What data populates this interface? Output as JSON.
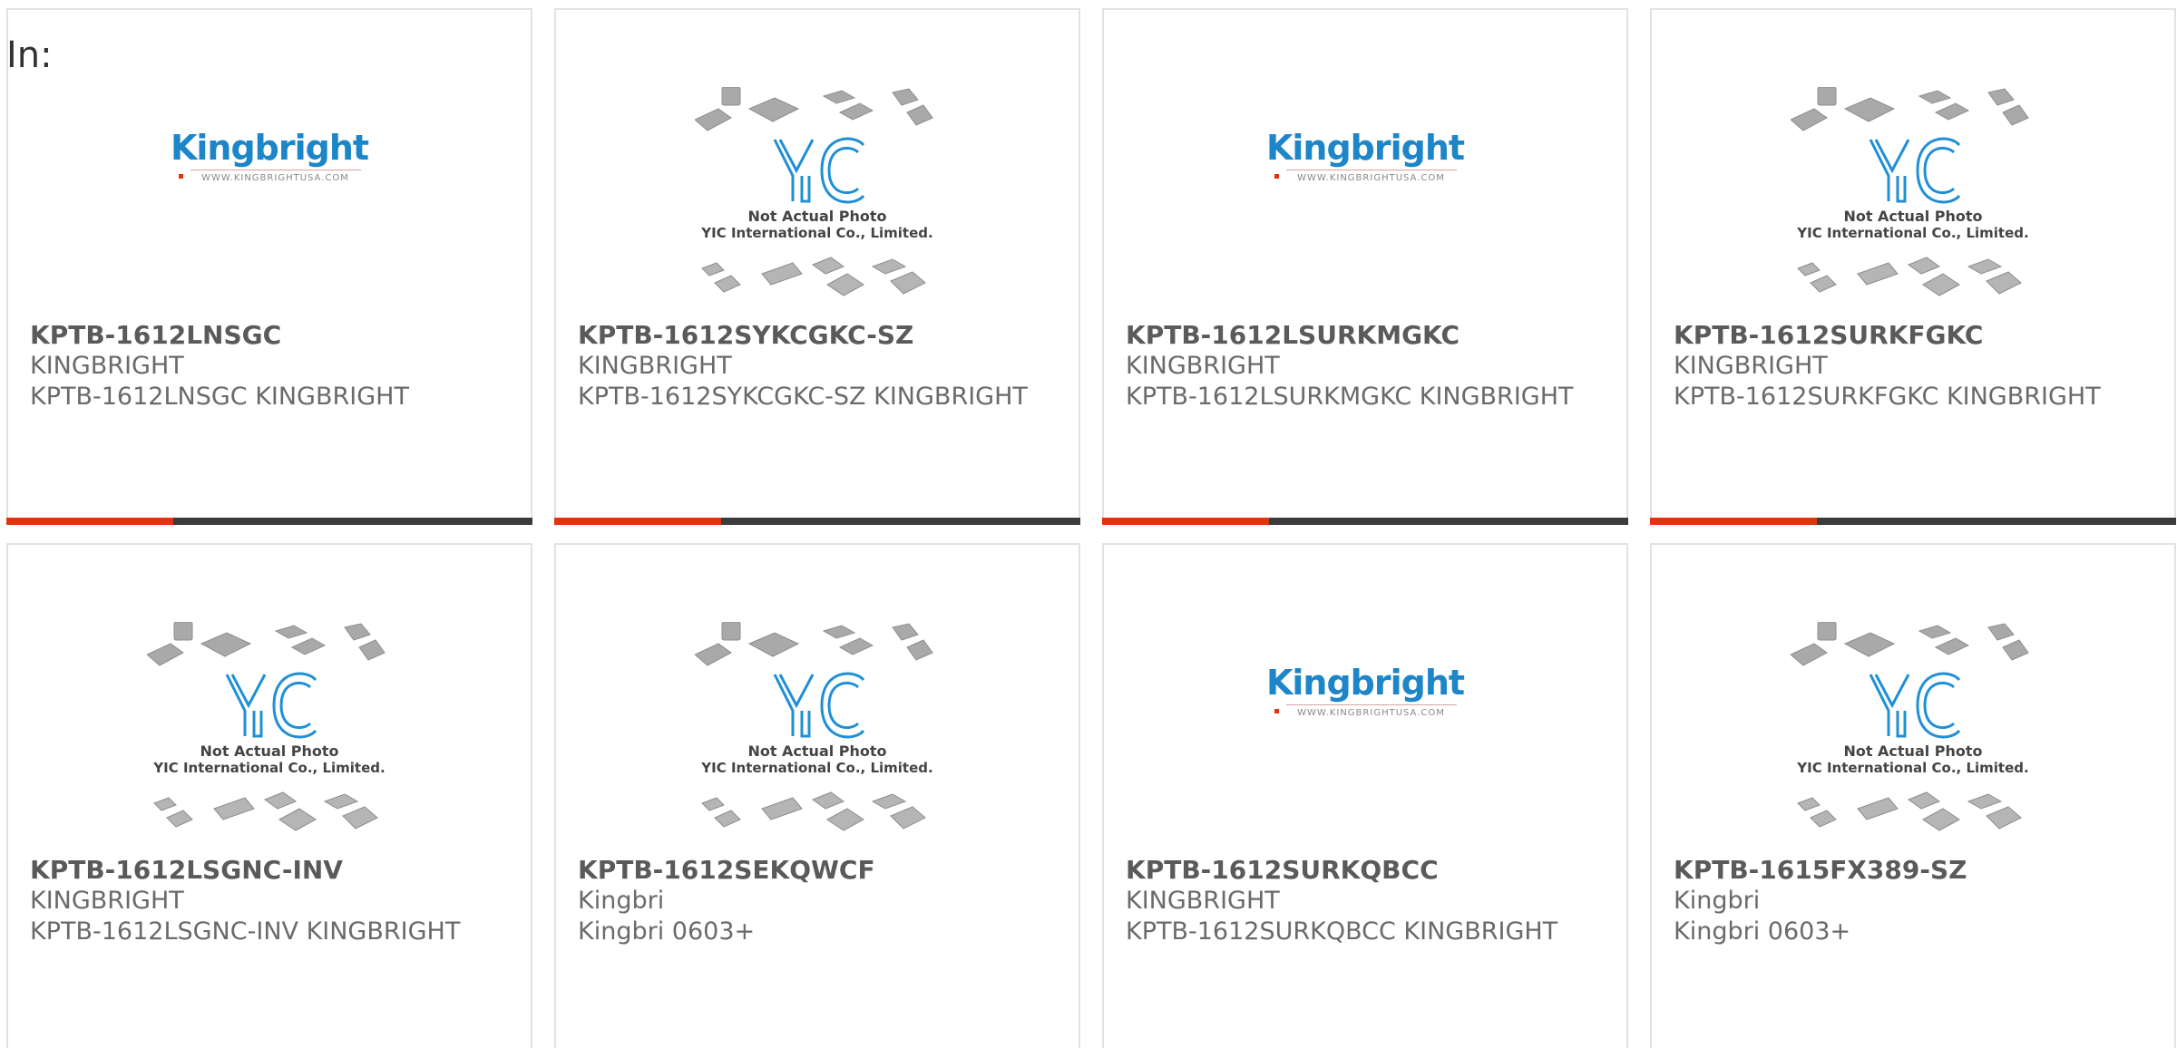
{
  "header": {
    "in_label": "In:"
  },
  "logos": {
    "kingbright_word": "Kingbright",
    "kingbright_url": "WWW.KINGBRIGHTUSA.COM",
    "yic_mark": "YIC",
    "yic_line1": "Not Actual Photo",
    "yic_line2": "YIC International Co., Limited."
  },
  "colors": {
    "accent": "#e0340f",
    "bar": "#3b3b3b",
    "brand_blue": "#1c86c8"
  },
  "products": [
    {
      "part_number": "KPTB-1612LNSGC",
      "manufacturer": "KINGBRIGHT",
      "description": "KPTB-1612LNSGC KINGBRIGHT",
      "image": "kingbright-logo"
    },
    {
      "part_number": "KPTB-1612SYKCGKC-SZ",
      "manufacturer": "KINGBRIGHT",
      "description": "KPTB-1612SYKCGKC-SZ KINGBRIGHT",
      "image": "yic-placeholder"
    },
    {
      "part_number": "KPTB-1612LSURKMGKC",
      "manufacturer": "KINGBRIGHT",
      "description": "KPTB-1612LSURKMGKC KINGBRIGHT",
      "image": "kingbright-logo"
    },
    {
      "part_number": "KPTB-1612SURKFGKC",
      "manufacturer": "KINGBRIGHT",
      "description": "KPTB-1612SURKFGKC KINGBRIGHT",
      "image": "yic-placeholder"
    },
    {
      "part_number": "KPTB-1612LSGNC-INV",
      "manufacturer": "KINGBRIGHT",
      "description": "KPTB-1612LSGNC-INV KINGBRIGHT",
      "image": "yic-placeholder"
    },
    {
      "part_number": "KPTB-1612SEKQWCF",
      "manufacturer": "Kingbri",
      "description": "Kingbri 0603+",
      "image": "yic-placeholder"
    },
    {
      "part_number": "KPTB-1612SURKQBCC",
      "manufacturer": "KINGBRIGHT",
      "description": "KPTB-1612SURKQBCC KINGBRIGHT",
      "image": "kingbright-logo"
    },
    {
      "part_number": "KPTB-1615FX389-SZ",
      "manufacturer": "Kingbri",
      "description": "Kingbri 0603+",
      "image": "yic-placeholder"
    }
  ]
}
